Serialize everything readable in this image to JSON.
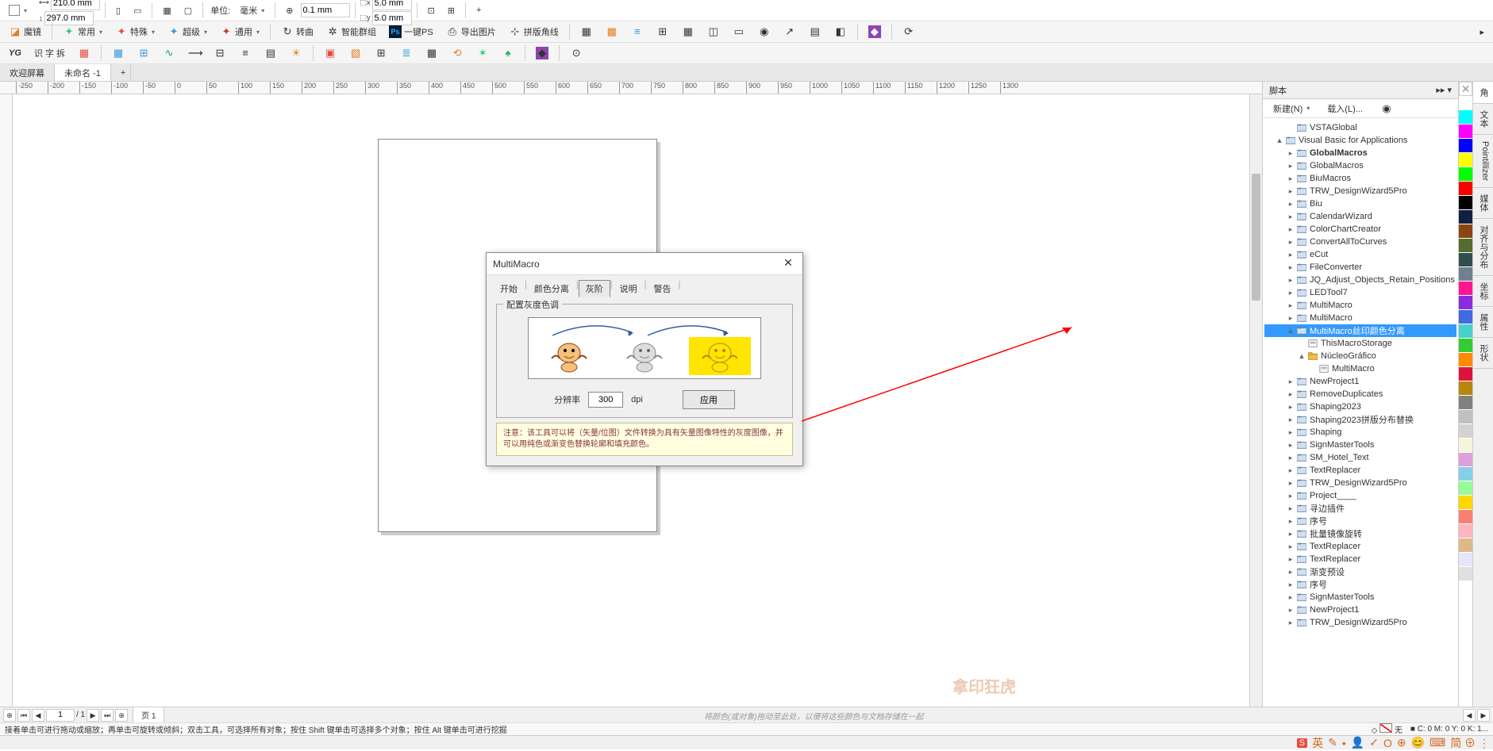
{
  "toolbar1": {
    "width": "210.0 mm",
    "height": "297.0 mm",
    "units_label": "单位:",
    "units_value": "毫米",
    "nudge": "0.1 mm",
    "dup_x": "5.0 mm",
    "dup_y": "5.0 mm"
  },
  "toolbar2": {
    "magic": "魔镜",
    "common": "常用",
    "special": "特殊",
    "super": "超级",
    "general": "通用",
    "convert": "转曲",
    "smart_group": "智能群组",
    "one_key_ps": "一键PS",
    "export_img": "导出图片",
    "tile_angle": "拼版角线"
  },
  "toolbar3": {
    "yg": "YG",
    "split": "识 字 拆"
  },
  "tabs": {
    "welcome": "欢迎屏幕",
    "doc1": "未命名 -1"
  },
  "ruler_ticks": [
    "-250",
    "-200",
    "-150",
    "-100",
    "-50",
    "0",
    "50",
    "100",
    "150",
    "200",
    "250",
    "300",
    "350",
    "400",
    "450",
    "500",
    "550",
    "600",
    "650",
    "700",
    "750",
    "800",
    "850",
    "900",
    "950",
    "1000",
    "1050",
    "1100",
    "1150",
    "1200",
    "1250",
    "1300"
  ],
  "dialog": {
    "title": "MultiMacro",
    "tabs": [
      "开始",
      "颜色分离",
      "灰阶",
      "说明",
      "警告"
    ],
    "active_tab": "灰阶",
    "fieldset": "配置灰度色调",
    "res_label": "分辨率",
    "res_value": "300",
    "dpi": "dpi",
    "apply": "应用",
    "note": "注意：该工具可以将（矢量/位图）文件转换为具有矢量图像特性的灰度图像，并可以用纯色或渐变色替换轮廓和填充颜色。"
  },
  "script_panel": {
    "title": "脚本",
    "new": "新建(N)",
    "load": "载入(L)...",
    "tree": [
      {
        "label": "VSTAGlobal",
        "indent": 2,
        "toggle": ""
      },
      {
        "label": "Visual Basic for Applications",
        "indent": 1,
        "toggle": "▲",
        "type": "root"
      },
      {
        "label": "GlobalMacros",
        "indent": 2,
        "toggle": "▸",
        "bold": true
      },
      {
        "label": "GlobalMacros",
        "indent": 2,
        "toggle": "▸"
      },
      {
        "label": "BiuMacros",
        "indent": 2,
        "toggle": "▸"
      },
      {
        "label": "TRW_DesignWizard5Pro",
        "indent": 2,
        "toggle": "▸"
      },
      {
        "label": "Biu",
        "indent": 2,
        "toggle": "▸"
      },
      {
        "label": "CalendarWizard",
        "indent": 2,
        "toggle": "▸"
      },
      {
        "label": "ColorChartCreator",
        "indent": 2,
        "toggle": "▸"
      },
      {
        "label": "ConvertAllToCurves",
        "indent": 2,
        "toggle": "▸"
      },
      {
        "label": "eCut",
        "indent": 2,
        "toggle": "▸"
      },
      {
        "label": "FileConverter",
        "indent": 2,
        "toggle": "▸"
      },
      {
        "label": "JQ_Adjust_Objects_Retain_Positions",
        "indent": 2,
        "toggle": "▸"
      },
      {
        "label": "LEDTool7",
        "indent": 2,
        "toggle": "▸"
      },
      {
        "label": "MultiMacro",
        "indent": 2,
        "toggle": "▸"
      },
      {
        "label": "MultiMacro",
        "indent": 2,
        "toggle": "▸"
      },
      {
        "label": "MultiMacro丝印颜色分离",
        "indent": 2,
        "toggle": "▲",
        "selected": true
      },
      {
        "label": "ThisMacroStorage",
        "indent": 3,
        "toggle": "",
        "type": "module"
      },
      {
        "label": "NúcleoGráfico",
        "indent": 3,
        "toggle": "▲",
        "type": "folder"
      },
      {
        "label": "MultiMacro",
        "indent": 4,
        "toggle": "",
        "type": "module"
      },
      {
        "label": "NewProject1",
        "indent": 2,
        "toggle": "▸"
      },
      {
        "label": "RemoveDuplicates",
        "indent": 2,
        "toggle": "▸"
      },
      {
        "label": "Shaping2023",
        "indent": 2,
        "toggle": "▸"
      },
      {
        "label": "Shaping2023拼版分布替换",
        "indent": 2,
        "toggle": "▸"
      },
      {
        "label": "Shaping",
        "indent": 2,
        "toggle": "▸"
      },
      {
        "label": "SignMasterTools",
        "indent": 2,
        "toggle": "▸"
      },
      {
        "label": "SM_Hotel_Text",
        "indent": 2,
        "toggle": "▸"
      },
      {
        "label": "TextReplacer",
        "indent": 2,
        "toggle": "▸"
      },
      {
        "label": "TRW_DesignWizard5Pro",
        "indent": 2,
        "toggle": "▸"
      },
      {
        "label": "Project____",
        "indent": 2,
        "toggle": "▸"
      },
      {
        "label": "寻边插件",
        "indent": 2,
        "toggle": "▸"
      },
      {
        "label": "序号",
        "indent": 2,
        "toggle": "▸"
      },
      {
        "label": "批量镜像旋转",
        "indent": 2,
        "toggle": "▸"
      },
      {
        "label": "TextReplacer",
        "indent": 2,
        "toggle": "▸"
      },
      {
        "label": "TextReplacer",
        "indent": 2,
        "toggle": "▸"
      },
      {
        "label": "渐变预设",
        "indent": 2,
        "toggle": "▸"
      },
      {
        "label": "序号",
        "indent": 2,
        "toggle": "▸"
      },
      {
        "label": "SignMasterTools",
        "indent": 2,
        "toggle": "▸"
      },
      {
        "label": "NewProject1",
        "indent": 2,
        "toggle": "▸"
      },
      {
        "label": "TRW_DesignWizard5Pro",
        "indent": 2,
        "toggle": "▸"
      }
    ]
  },
  "vtabs": [
    "角",
    "文本",
    "Pointillizer",
    "媒体",
    "对齐与分布",
    "坐标",
    "属性",
    "形状"
  ],
  "colors": [
    "#ffffff",
    "#00ffff",
    "#ff00ff",
    "#0000ff",
    "#ffff00",
    "#00ff00",
    "#ff0000",
    "#000000",
    "#102040",
    "#8b4513",
    "#556b2f",
    "#2f4f4f",
    "#708090",
    "#ff1493",
    "#8a2be2",
    "#4169e1",
    "#48d1cc",
    "#32cd32",
    "#ff8c00",
    "#dc143c",
    "#b8860b",
    "#808080",
    "#c0c0c0",
    "#d3d3d3",
    "#f5f5dc",
    "#dda0dd",
    "#87ceeb",
    "#98fb98",
    "#ffd700",
    "#fa8072",
    "#ffb6c1",
    "#deb887",
    "#e6e6fa",
    "#e0e0e0"
  ],
  "page_nav": {
    "page_num": "1",
    "total": "1",
    "page_label": "页 1"
  },
  "color_hint": "将颜色(或对象)拖动至此处，以便将这些颜色与文档存储在一起",
  "status": {
    "hint": "接着单击可进行拖动或缩放；再单击可旋转或倾斜；双击工具，可选择所有对象；按住 Shift 键单击可选择多个对象；按住 Alt 键单击可进行挖掘",
    "none": "无",
    "coords": "C: 0 M: 0 Y: 0 K: 1..."
  },
  "taskbar": {
    "ime": "英",
    "extra": "简 ⊕ ⋮"
  },
  "watermark": "拿印狂虎"
}
